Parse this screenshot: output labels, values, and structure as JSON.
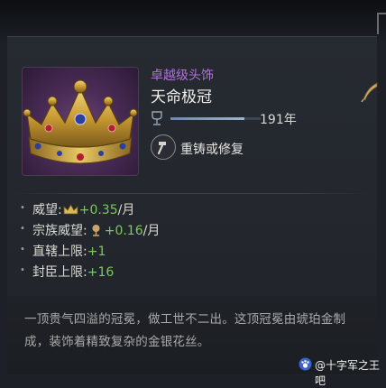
{
  "item": {
    "rarity": "卓越级头饰",
    "name": "天命极冠",
    "age_value": "191年",
    "age_fill": 0.82,
    "reforge_label": "重铸或修复"
  },
  "modifiers": [
    {
      "label": "威望:",
      "icon": "crown-prestige-icon",
      "value": "+0.35",
      "suffix": "/月"
    },
    {
      "label": "宗族威望:",
      "icon": "dynasty-tree-icon",
      "value": "+0.16",
      "suffix": "/月"
    },
    {
      "label": "直辖上限:",
      "icon": "",
      "value": "+1",
      "suffix": ""
    },
    {
      "label": "封臣上限:",
      "icon": "",
      "value": "+16",
      "suffix": ""
    }
  ],
  "description": {
    "line1": "一顶贵气四溢的冠冕，做工世不二出。这顶冠冕由琥珀金制",
    "line2": "成，装饰着精致复杂的金银花丝。"
  },
  "watermark": {
    "text": "@十字军之王吧"
  },
  "colors": {
    "rarity": "#b074d8",
    "positive_value": "#7bc95a",
    "panel": "#23272d",
    "portrait_bg": "#4a2c57"
  }
}
